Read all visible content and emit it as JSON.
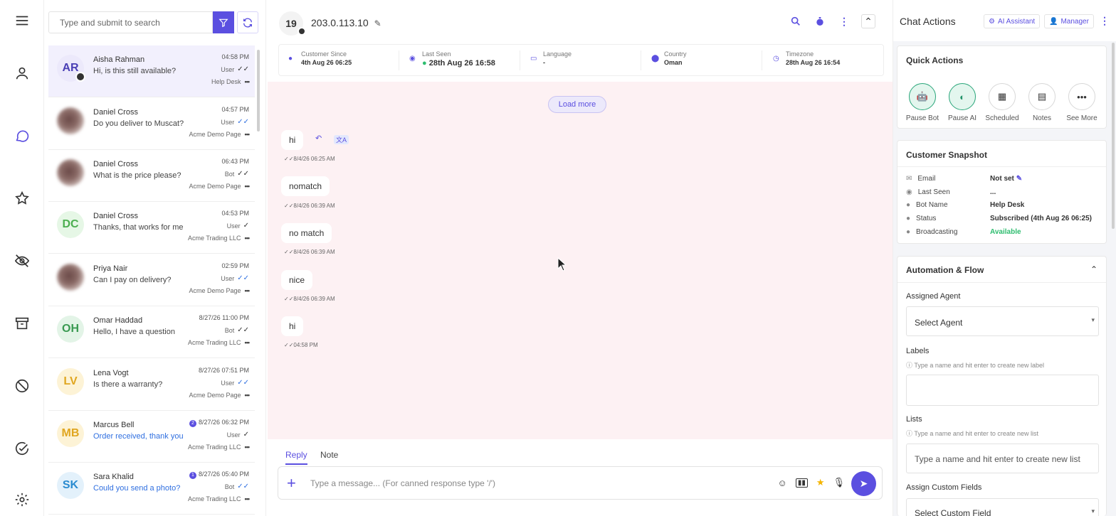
{
  "nav": {
    "items": [
      "menu-icon",
      "user-icon",
      "chat-icon",
      "star-icon",
      "hidden-icon",
      "archive-icon",
      "block-icon",
      "check-icon",
      "gear-icon"
    ]
  },
  "search": {
    "placeholder": "Type and submit to search"
  },
  "conversations": [
    {
      "initials": "AR",
      "name": "Aisha Rahman",
      "msg": "Hi, is this still available?",
      "time": "04:58 PM",
      "sender": "User",
      "page": "Help Desk",
      "avatar_bg": "#ece9fb",
      "avatar_fg": "#4a3fb5"
    },
    {
      "initials": "",
      "name": "Daniel Cross",
      "msg": "Do you deliver to Muscat?",
      "time": "04:57 PM",
      "sender": "User",
      "page": "Acme Demo Page"
    },
    {
      "initials": "",
      "name": "Daniel Cross",
      "msg": "What is the price please?",
      "time": "06:43 PM",
      "sender": "Bot",
      "page": "Acme Demo Page"
    },
    {
      "initials": "DC",
      "name": "Daniel Cross",
      "msg": "Thanks, that works for me",
      "time": "04:53 PM",
      "sender": "User",
      "page": "Acme Trading LLC",
      "avatar_bg": "#e6f7e6",
      "avatar_fg": "#4caf50"
    },
    {
      "initials": "",
      "name": "Priya Nair",
      "msg": "Can I pay on delivery?",
      "time": "02:59 PM",
      "sender": "User",
      "page": "Acme Demo Page"
    },
    {
      "initials": "OH",
      "name": "Omar Haddad",
      "msg": "Hello, I have a question",
      "time": "8/27/26 11:00 PM",
      "sender": "Bot",
      "page": "Acme Trading LLC",
      "avatar_bg": "#e3f4e7",
      "avatar_fg": "#3a9a52"
    },
    {
      "initials": "LV",
      "name": "Lena Vogt",
      "msg": "Is there a warranty?",
      "time": "8/27/26 07:51 PM",
      "sender": "User",
      "page": "Acme Demo Page",
      "avatar_bg": "#fdf3d6",
      "avatar_fg": "#e0a620"
    },
    {
      "initials": "MB",
      "name": "Marcus Bell",
      "msg": "Order received, thank you",
      "time": "8/27/26 06:32 PM",
      "sender": "User",
      "page": "Acme Trading LLC",
      "avatar_bg": "#fdf3d6",
      "avatar_fg": "#e0a620",
      "unread": "2"
    },
    {
      "initials": "SK",
      "name": "Sara Khalid",
      "msg": "Could you send a photo?",
      "time": "8/27/26 05:40 PM",
      "sender": "Bot",
      "page": "Acme Trading LLC",
      "avatar_bg": "#e3f1fb",
      "avatar_fg": "#2a8bd0",
      "unread": "1"
    }
  ],
  "chat": {
    "avatar": "19",
    "ip": "203.0.113.10",
    "info": [
      {
        "label": "Customer Since",
        "value": "4th Aug 26 06:25"
      },
      {
        "label": "Last Seen",
        "value": "28th Aug 26 16:58"
      },
      {
        "label": "Language",
        "value": "-"
      },
      {
        "label": "Country",
        "value": "Oman"
      },
      {
        "label": "Timezone",
        "value": "28th Aug 26 16:54"
      }
    ],
    "load_more": "Load more",
    "messages": [
      {
        "text": "hi",
        "time": "8/4/26 06:25 AM"
      },
      {
        "text": "nomatch",
        "time": "8/4/26 06:39 AM"
      },
      {
        "text": "no match",
        "time": "8/4/26 06:39 AM"
      },
      {
        "text": "nice",
        "time": "8/4/26 06:39 AM"
      },
      {
        "text": "hi",
        "time": "04:58 PM"
      }
    ],
    "tabs": [
      "Reply",
      "Note"
    ],
    "composer_placeholder": "Type a message... (For canned response type '/')"
  },
  "right": {
    "title": "Chat Actions",
    "ai_assistant": "AI Assistant",
    "manager": "Manager",
    "quick_actions_title": "Quick Actions",
    "quick_actions": [
      "Pause Bot",
      "Pause AI",
      "Scheduled",
      "Notes",
      "See More"
    ],
    "snapshot_title": "Customer Snapshot",
    "snapshot": [
      {
        "label": "Email",
        "value": "Not set"
      },
      {
        "label": "Last Seen",
        "value": "..."
      },
      {
        "label": "Bot Name",
        "value": "Help Desk"
      },
      {
        "label": "Status",
        "value": "Subscribed (4th Aug 26 06:25)"
      },
      {
        "label": "Broadcasting",
        "value": "Available"
      }
    ],
    "automation_title": "Automation & Flow",
    "assigned_agent_label": "Assigned Agent",
    "assigned_agent_value": "Select Agent",
    "labels_label": "Labels",
    "labels_hint": "Type a name and hit enter to create new label",
    "lists_label": "Lists",
    "lists_hint": "Type a name and hit enter to create new list",
    "lists_placeholder": "Type a name and hit enter to create new list",
    "custom_fields_label": "Assign Custom Fields",
    "custom_fields_value": "Select Custom Field"
  },
  "colors": {
    "accent": "#5b4fe0",
    "chat_bg": "#fdf1f3",
    "green": "#2ebd6f"
  }
}
